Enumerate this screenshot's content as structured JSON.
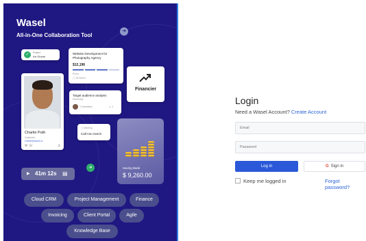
{
  "hero": {
    "brand": "Wasel",
    "tagline": "All-in-One Collaboration Tool",
    "bg_color": "#1f1782",
    "project_card": {
      "meta": "Project",
      "name": "Art Global"
    },
    "website_card": {
      "title": "Website Development for Photography Agency",
      "amount": "$12,196",
      "sub": "Photo",
      "date": "28 March"
    },
    "financier_card": {
      "label": "Financier",
      "icon": "trend-up-icon"
    },
    "person_card": {
      "name": "Charlie Puth",
      "role": "Customer",
      "email": "charlie@wasel.io"
    },
    "target_card": {
      "title": "Target audience analysis",
      "sub": "Marketing",
      "meta": "3 members",
      "count": "1"
    },
    "call_card": {
      "meta": "Meeting",
      "title": "Call Ann Harris"
    },
    "saving_card": {
      "label": "Saving Bank",
      "amount": "$ 9,260.00"
    },
    "timer": {
      "time": "41m 12s"
    },
    "chips": [
      "Cloud CRM",
      "Project Management",
      "Finance",
      "Invoicing",
      "Client Portal",
      "Agile",
      "Knowledge Base"
    ]
  },
  "login": {
    "title": "Login",
    "prompt": "Need a Wasel Account?",
    "create_link": "Create Account",
    "email_placeholder": "Email",
    "password_placeholder": "Password",
    "login_button": "Log in",
    "google_button": "Sign in",
    "remember": "Keep me logged in",
    "forgot": "Forgot password?",
    "accent_color": "#2a58d8"
  }
}
